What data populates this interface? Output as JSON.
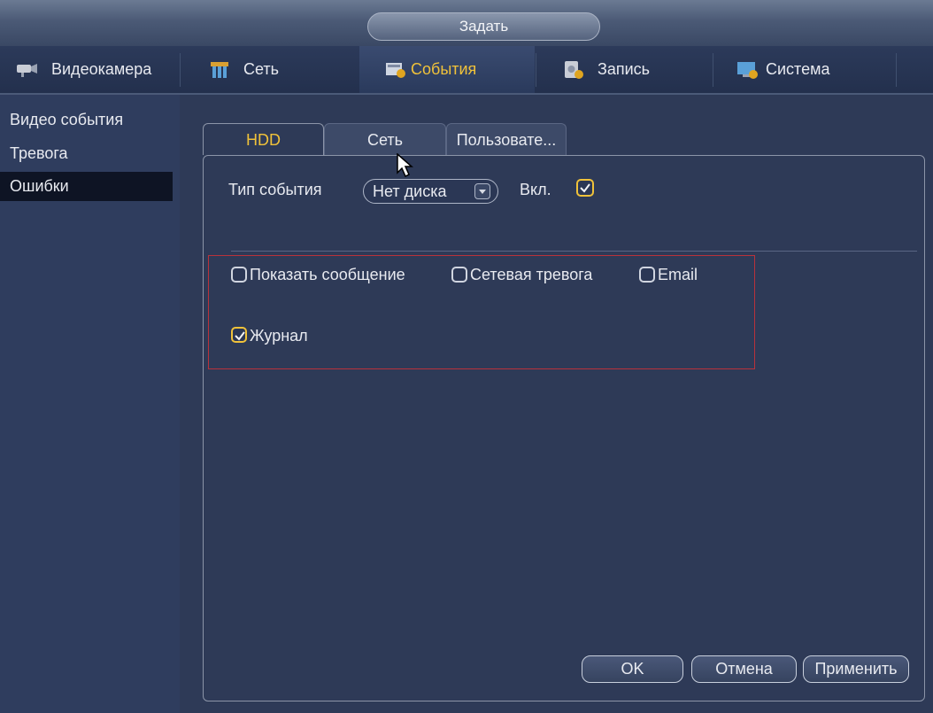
{
  "window": {
    "title": "Задать"
  },
  "nav": [
    {
      "label": "Видеокамера",
      "icon": "camera-icon",
      "active": false
    },
    {
      "label": "Сеть",
      "icon": "network-icon",
      "active": false
    },
    {
      "label": "События",
      "icon": "events-icon",
      "active": true
    },
    {
      "label": "Запись",
      "icon": "storage-icon",
      "active": false
    },
    {
      "label": "Система",
      "icon": "system-icon",
      "active": false
    }
  ],
  "sidebar": [
    {
      "label": "Видео события",
      "active": false
    },
    {
      "label": "Тревога",
      "active": false
    },
    {
      "label": "Ошибки",
      "active": true
    }
  ],
  "tabs": [
    {
      "label": "HDD",
      "active": true
    },
    {
      "label": "Сеть",
      "active": false
    },
    {
      "label": "Пользовате...",
      "active": false
    }
  ],
  "form": {
    "event_type_label": "Тип события",
    "event_type_value": "Нет диска",
    "enable_label": "Вкл.",
    "enable_checked": true,
    "options": [
      {
        "label": "Показать сообщение",
        "checked": false
      },
      {
        "label": "Сетевая тревога",
        "checked": false
      },
      {
        "label": "Email",
        "checked": false
      },
      {
        "label": "Журнал",
        "checked": true
      }
    ]
  },
  "buttons": {
    "ok": "OK",
    "cancel": "Отмена",
    "apply": "Применить"
  },
  "colors": {
    "accent": "#f0c23a",
    "highlight_box": "#b8323b",
    "background": "#2e3a57"
  }
}
